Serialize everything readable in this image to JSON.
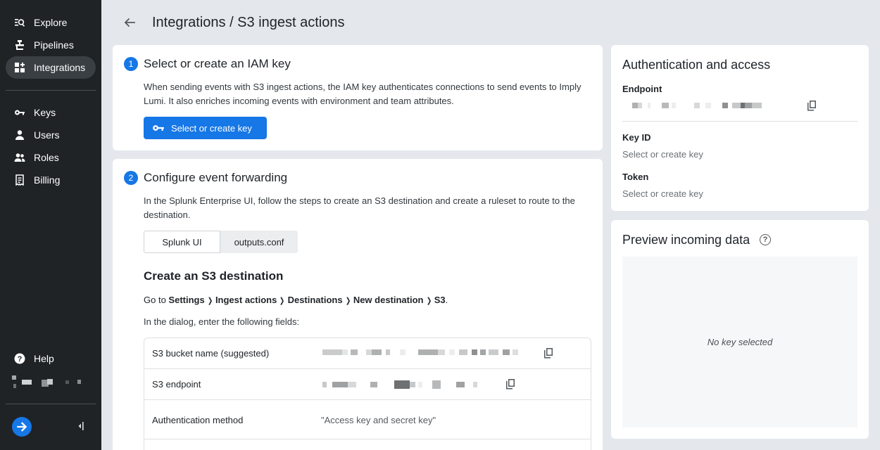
{
  "sidebar": {
    "nav_top": [
      {
        "label": "Explore",
        "icon": "explore-icon"
      },
      {
        "label": "Pipelines",
        "icon": "pipelines-icon"
      },
      {
        "label": "Integrations",
        "icon": "integrations-icon",
        "active": true
      }
    ],
    "nav_admin": [
      {
        "label": "Keys",
        "icon": "key-icon"
      },
      {
        "label": "Users",
        "icon": "user-icon"
      },
      {
        "label": "Roles",
        "icon": "roles-icon"
      },
      {
        "label": "Billing",
        "icon": "billing-icon"
      }
    ],
    "help_label": "Help"
  },
  "header": {
    "title": "Integrations / S3 ingest actions"
  },
  "step1": {
    "number": "1",
    "title": "Select or create an IAM key",
    "description": "When sending events with S3 ingest actions, the IAM key authenticates connections to send events to Imply Lumi. It also enriches incoming events with environment and team attributes.",
    "button_label": "Select or create key"
  },
  "step2": {
    "number": "2",
    "title": "Configure event forwarding",
    "description": "In the Splunk Enterprise UI, follow the steps to create an S3 destination and create a ruleset to route to the destination.",
    "tabs": [
      "Splunk UI",
      "outputs.conf"
    ],
    "section_title": "Create an S3 destination",
    "goto_prefix": "Go to",
    "path": [
      "Settings",
      "Ingest actions",
      "Destinations",
      "New destination",
      "S3"
    ],
    "dialog_text": "In the dialog, enter the following fields:",
    "fields": [
      {
        "label": "S3 bucket name (suggested)",
        "value": ""
      },
      {
        "label": "S3 endpoint",
        "value": ""
      },
      {
        "label": "Authentication method",
        "value": "\"Access key and secret key\""
      }
    ]
  },
  "auth": {
    "title": "Authentication and access",
    "endpoint_label": "Endpoint",
    "key_id_label": "Key ID",
    "key_id_value": "Select or create key",
    "token_label": "Token",
    "token_value": "Select or create key"
  },
  "preview": {
    "title": "Preview incoming data",
    "empty_text": "No key selected"
  },
  "colors": {
    "accent": "#1677e6",
    "sidebar_bg": "#1f2326",
    "page_bg": "#e4e8ec"
  }
}
